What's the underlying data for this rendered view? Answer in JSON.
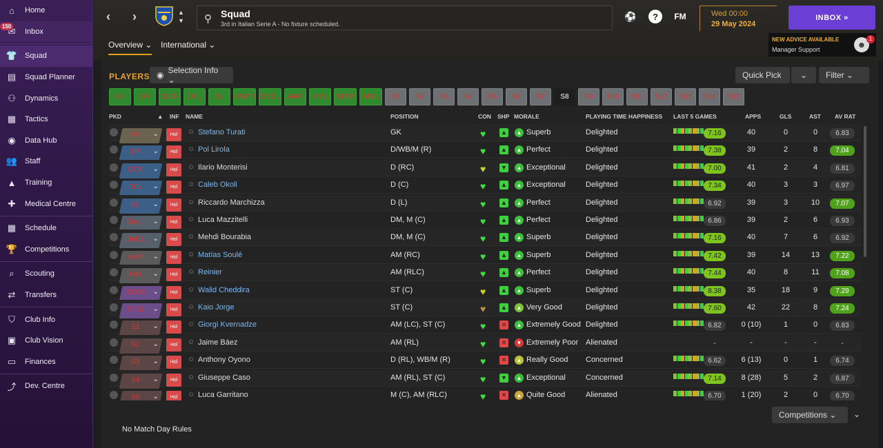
{
  "sidebar": {
    "items": [
      {
        "label": "Home",
        "icon": "home-icon"
      },
      {
        "label": "Inbox",
        "icon": "inbox-icon",
        "badge": "150"
      },
      {
        "label": "Squad",
        "icon": "shirt-icon"
      },
      {
        "label": "Squad Planner",
        "icon": "planner-icon"
      },
      {
        "label": "Dynamics",
        "icon": "dynamics-icon"
      },
      {
        "label": "Tactics",
        "icon": "tactics-icon"
      },
      {
        "label": "Data Hub",
        "icon": "datahub-icon"
      },
      {
        "label": "Staff",
        "icon": "staff-icon"
      },
      {
        "label": "Training",
        "icon": "training-icon"
      },
      {
        "label": "Medical Centre",
        "icon": "medical-icon"
      },
      {
        "label": "Schedule",
        "icon": "calendar-icon"
      },
      {
        "label": "Competitions",
        "icon": "trophy-icon"
      },
      {
        "label": "Scouting",
        "icon": "scouting-icon"
      },
      {
        "label": "Transfers",
        "icon": "transfers-icon"
      },
      {
        "label": "Club Info",
        "icon": "shield-icon"
      },
      {
        "label": "Club Vision",
        "icon": "briefcase-icon"
      },
      {
        "label": "Finances",
        "icon": "finances-icon"
      },
      {
        "label": "Dev. Centre",
        "icon": "dev-centre-icon"
      }
    ]
  },
  "header": {
    "title": "Squad",
    "subtitle": "3rd in Italian Serie A - No fixture scheduled.",
    "help": "?",
    "fm": "FM",
    "date_day": "Wed 00:00",
    "date_full": "29 May 2024",
    "inbox_label": "INBOX »",
    "advice_title": "NEW ADVICE AVAILABLE",
    "advice_sub": "Manager Support",
    "advice_badge": "1"
  },
  "tabs": [
    {
      "label": "Overview ⌄"
    },
    {
      "label": "International ⌄"
    }
  ],
  "players": {
    "title": "PLAYERS",
    "selection_info": "Selection Info ⌄",
    "quick_pick": "Quick Pick",
    "filter": "Filter ⌄"
  },
  "position_buttons": [
    "GK",
    "DR",
    "DCR",
    "DCL",
    "DL",
    "DMCR",
    "DMCL",
    "AMR",
    "AML",
    "STCR",
    "STCL",
    "S1",
    "S2",
    "S3",
    "S4",
    "S5",
    "S6",
    "S7",
    "S8",
    "S9",
    "S10",
    "S11",
    "S12",
    "S13",
    "S14",
    "S15"
  ],
  "columns": {
    "pkd": "PKD",
    "inf": "INF",
    "name": "NAME",
    "position": "POSITION",
    "con": "CON",
    "shp": "SHP",
    "morale": "MORALE",
    "happiness": "PLAYING TIME HAPPINESS",
    "last5": "LAST 5 GAMES",
    "apps": "APPS",
    "gls": "GLS",
    "ast": "AST",
    "avrat": "AV RAT"
  },
  "rows": [
    {
      "pkd": "GK",
      "inf": "Hol",
      "name": "Stefano Turati",
      "position": "GK",
      "con": "g",
      "shp": "up",
      "morale": "Superb",
      "happiness": "Delighted",
      "last5": "7.16",
      "apps": "40",
      "gls": "0",
      "ast": "0",
      "avrat": "6.83"
    },
    {
      "pkd": "DR",
      "inf": "Hol",
      "name": "Pol Lirola",
      "position": "D/WB/M (R)",
      "con": "g",
      "shp": "up",
      "morale": "Perfect",
      "happiness": "Delighted",
      "last5": "7.38",
      "apps": "39",
      "gls": "2",
      "ast": "8",
      "avrat": "7.04"
    },
    {
      "pkd": "DCR",
      "inf": "Hol",
      "name": "Ilario Monterisi",
      "position": "D (RC)",
      "con": "y",
      "shp": "down",
      "morale": "Exceptional",
      "happiness": "Delighted",
      "last5": "7.00",
      "apps": "41",
      "gls": "2",
      "ast": "4",
      "avrat": "6.81"
    },
    {
      "pkd": "DCL",
      "inf": "Hol",
      "name": "Caleb Okoli",
      "position": "D (C)",
      "con": "g",
      "shp": "up",
      "morale": "Exceptional",
      "happiness": "Delighted",
      "last5": "7.34",
      "apps": "40",
      "gls": "3",
      "ast": "3",
      "avrat": "6.97"
    },
    {
      "pkd": "DL",
      "inf": "Hol",
      "name": "Riccardo Marchizza",
      "position": "D (L)",
      "con": "g",
      "shp": "up",
      "morale": "Perfect",
      "happiness": "Delighted",
      "last5": "6.92",
      "apps": "39",
      "gls": "3",
      "ast": "10",
      "avrat": "7.07"
    },
    {
      "pkd": "DM...",
      "inf": "Hol",
      "name": "Luca Mazzitelli",
      "position": "DM, M (C)",
      "con": "g",
      "shp": "up",
      "morale": "Perfect",
      "happiness": "Delighted",
      "last5": "6.86",
      "apps": "39",
      "gls": "2",
      "ast": "6",
      "avrat": "6.93"
    },
    {
      "pkd": "DMCL",
      "inf": "Hol",
      "name": "Mehdi Bourabia",
      "position": "DM, M (C)",
      "con": "g",
      "shp": "up",
      "morale": "Superb",
      "happiness": "Delighted",
      "last5": "7.16",
      "apps": "40",
      "gls": "7",
      "ast": "6",
      "avrat": "6.92"
    },
    {
      "pkd": "AMR",
      "inf": "Hol",
      "name": "Matías Soulé",
      "position": "AM (RC)",
      "con": "g",
      "shp": "up",
      "morale": "Superb",
      "happiness": "Delighted",
      "last5": "7.42",
      "apps": "39",
      "gls": "14",
      "ast": "13",
      "avrat": "7.22"
    },
    {
      "pkd": "AML",
      "inf": "Hol",
      "name": "Reinier",
      "position": "AM (RLC)",
      "con": "g",
      "shp": "up",
      "morale": "Perfect",
      "happiness": "Delighted",
      "last5": "7.44",
      "apps": "40",
      "gls": "8",
      "ast": "11",
      "avrat": "7.08"
    },
    {
      "pkd": "STCR",
      "inf": "Hol",
      "name": "Walid Cheddira",
      "position": "ST (C)",
      "con": "y",
      "shp": "up",
      "morale": "Superb",
      "happiness": "Delighted",
      "last5": "8.38",
      "apps": "35",
      "gls": "18",
      "ast": "9",
      "avrat": "7.29"
    },
    {
      "pkd": "STCL",
      "inf": "Hol",
      "name": "Kaio Jorge",
      "position": "ST (C)",
      "con": "b",
      "shp": "up",
      "morale": "Very Good",
      "happiness": "Delighted",
      "last5": "7.60",
      "apps": "42",
      "gls": "22",
      "ast": "8",
      "avrat": "7.24"
    },
    {
      "pkd": "S1",
      "inf": "Hol",
      "name": "Giorgi Kvernadze",
      "position": "AM (LC), ST (C)",
      "con": "g",
      "shp": "red",
      "morale": "Extremely Good",
      "happiness": "Delighted",
      "last5": "6.82",
      "apps": "0 (10)",
      "gls": "1",
      "ast": "0",
      "avrat": "6.83"
    },
    {
      "pkd": "S2",
      "inf": "Hol",
      "name": "Jaime Báez",
      "position": "AM (RL)",
      "con": "g",
      "shp": "red",
      "morale": "Extremely Poor",
      "happiness": "Alienated",
      "last5": "-",
      "apps": "-",
      "gls": "-",
      "ast": "-",
      "avrat": "-"
    },
    {
      "pkd": "S3",
      "inf": "Hol",
      "name": "Anthony Oyono",
      "position": "D (RL), WB/M (R)",
      "con": "g",
      "shp": "red",
      "morale": "Really Good",
      "happiness": "Concerned",
      "last5": "6.62",
      "apps": "6 (13)",
      "gls": "0",
      "ast": "1",
      "avrat": "6.74"
    },
    {
      "pkd": "S4",
      "inf": "Hol",
      "name": "Giuseppe Caso",
      "position": "AM (RL), ST (C)",
      "con": "g",
      "shp": "down",
      "morale": "Exceptional",
      "happiness": "Concerned",
      "last5": "7.14",
      "apps": "8 (28)",
      "gls": "5",
      "ast": "2",
      "avrat": "6.87"
    },
    {
      "pkd": "S5",
      "inf": "Hol",
      "name": "Luca Garritano",
      "position": "M (C), AM (RLC)",
      "con": "g",
      "shp": "red",
      "morale": "Quite Good",
      "happiness": "Alienated",
      "last5": "6.70",
      "apps": "1 (20)",
      "gls": "2",
      "ast": "0",
      "avrat": "6.70"
    }
  ],
  "footer": {
    "competitions": "Competitions ⌄",
    "match_day_rules": "No Match Day Rules"
  },
  "colors": {
    "accent": "#e8a22a",
    "inbox": "#6b3fd6",
    "link": "#7cb9f0",
    "green": "#3fe03f"
  }
}
